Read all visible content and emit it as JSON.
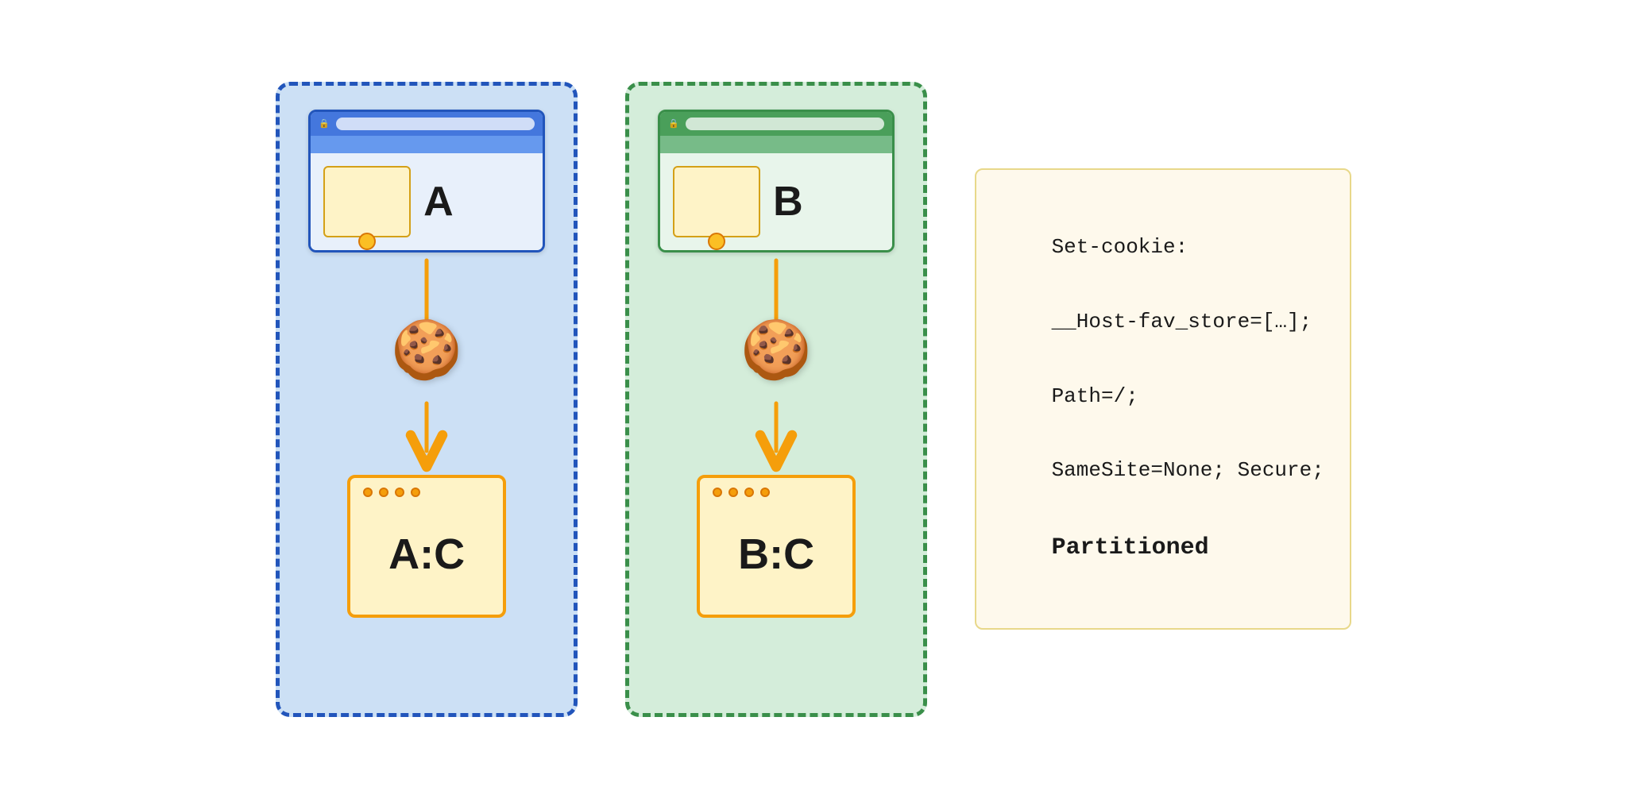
{
  "left_partition": {
    "label": "A",
    "storage_label": "A:C",
    "bg_color": "#cce0f5",
    "border_color": "#2255bb",
    "titlebar_color": "#4477dd",
    "toolbar_color": "#6699ee",
    "content_color": "#e8f0fb"
  },
  "right_partition": {
    "label": "B",
    "storage_label": "B:C",
    "bg_color": "#d4edda",
    "border_color": "#3a8f4a",
    "titlebar_color": "#4a9f5a",
    "toolbar_color": "#77bb88",
    "content_color": "#e8f5eb"
  },
  "code_block": {
    "line1": "Set-cookie:",
    "line2": "__Host-fav_store=[…];",
    "line3": "Path=/;",
    "line4": "SameSite=None; Secure;",
    "line5_bold": "Partitioned"
  },
  "cookie_emoji": "🍪"
}
